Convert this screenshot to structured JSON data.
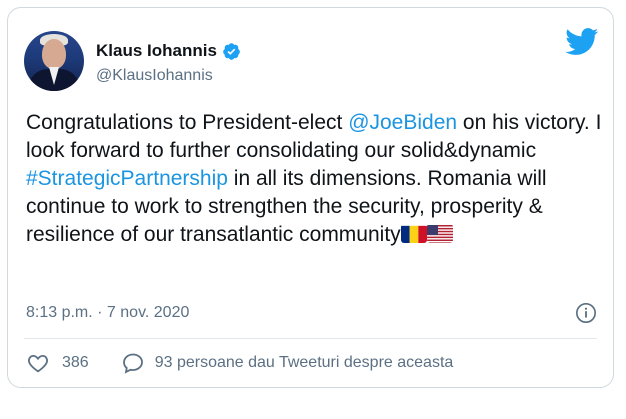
{
  "author": {
    "name": "Klaus Iohannis",
    "handle": "@KlausIohannis",
    "verified": true
  },
  "tweet": {
    "part1": "Congratulations to President-elect ",
    "mention": "@JoeBiden",
    "part2": " on his victory. I look forward to further consolidating our solid&dynamic ",
    "hashtag": "#StrategicPartnership",
    "part3": " in all its dimensions. Romania will continue to work to strengthen the security, prosperity & resilience of our transatlantic community"
  },
  "meta": {
    "timestamp": "8:13 p.m. · 7 nov. 2020"
  },
  "actions": {
    "likes": "386",
    "replies_text": "93 persoane dau Tweeturi despre aceasta"
  },
  "icons": {
    "brand": "twitter-bird-icon",
    "verified": "verified-badge-icon",
    "info": "info-icon",
    "like": "heart-icon",
    "reply": "speech-bubble-icon"
  },
  "colors": {
    "link": "#1b95e0",
    "brand": "#1da1f2",
    "muted": "#5b7083"
  }
}
